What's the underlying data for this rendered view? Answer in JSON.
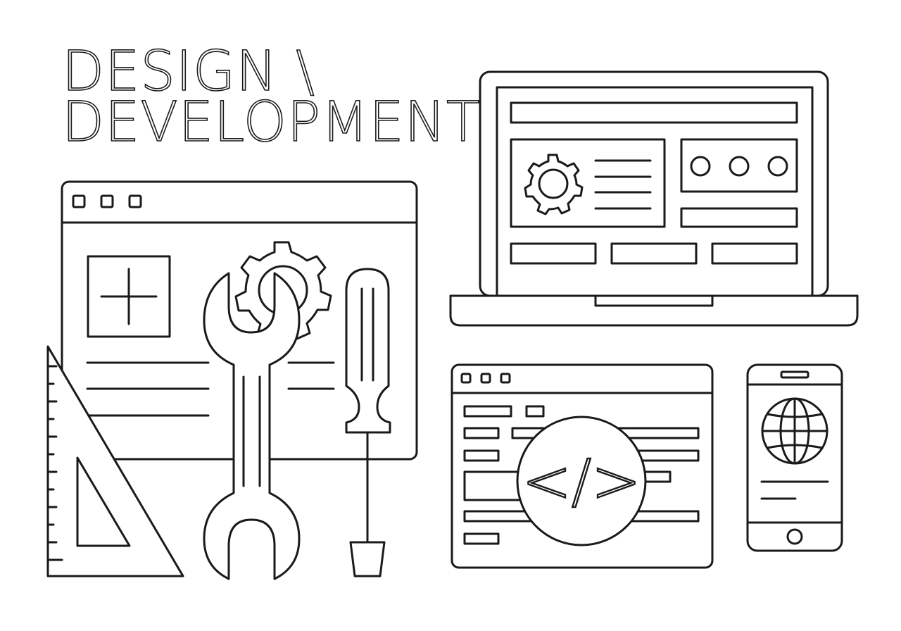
{
  "headline": {
    "line1": "DESIGN \\",
    "line2": "DEVELOPMENT"
  },
  "code_symbol": "</>",
  "colors": {
    "line": "#1a1a1a",
    "background": "#ffffff"
  },
  "icons": [
    "browser-window-icon",
    "plus-icon",
    "gear-icon",
    "wrench-icon",
    "screwdriver-icon",
    "set-square-icon",
    "laptop-icon",
    "code-window-icon",
    "smartphone-icon",
    "globe-icon"
  ]
}
